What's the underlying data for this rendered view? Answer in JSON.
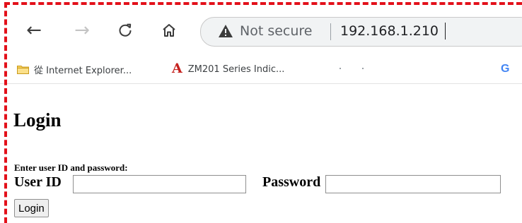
{
  "browser": {
    "omnibox": {
      "security_label": "Not secure",
      "url": "192.168.1.210"
    },
    "bookmarks": [
      {
        "icon": "folder-icon",
        "label": "從 Internet Explorer..."
      },
      {
        "icon": "acrobat-icon",
        "glyph": "A",
        "label": "ZM201 Series Indic..."
      },
      {
        "icon": "google-icon",
        "glyph": "G"
      }
    ]
  },
  "page": {
    "title": "Login",
    "instructions": "Enter user ID and password:",
    "user_id_label": "User ID",
    "user_id_value": "",
    "password_label": "Password",
    "password_value": "",
    "submit_label": "Login"
  },
  "colors": {
    "annotation": "#e3101a",
    "omnibox_bg": "#f1f3f4",
    "acrobat": "#c5221f",
    "google": "#4285f4"
  }
}
